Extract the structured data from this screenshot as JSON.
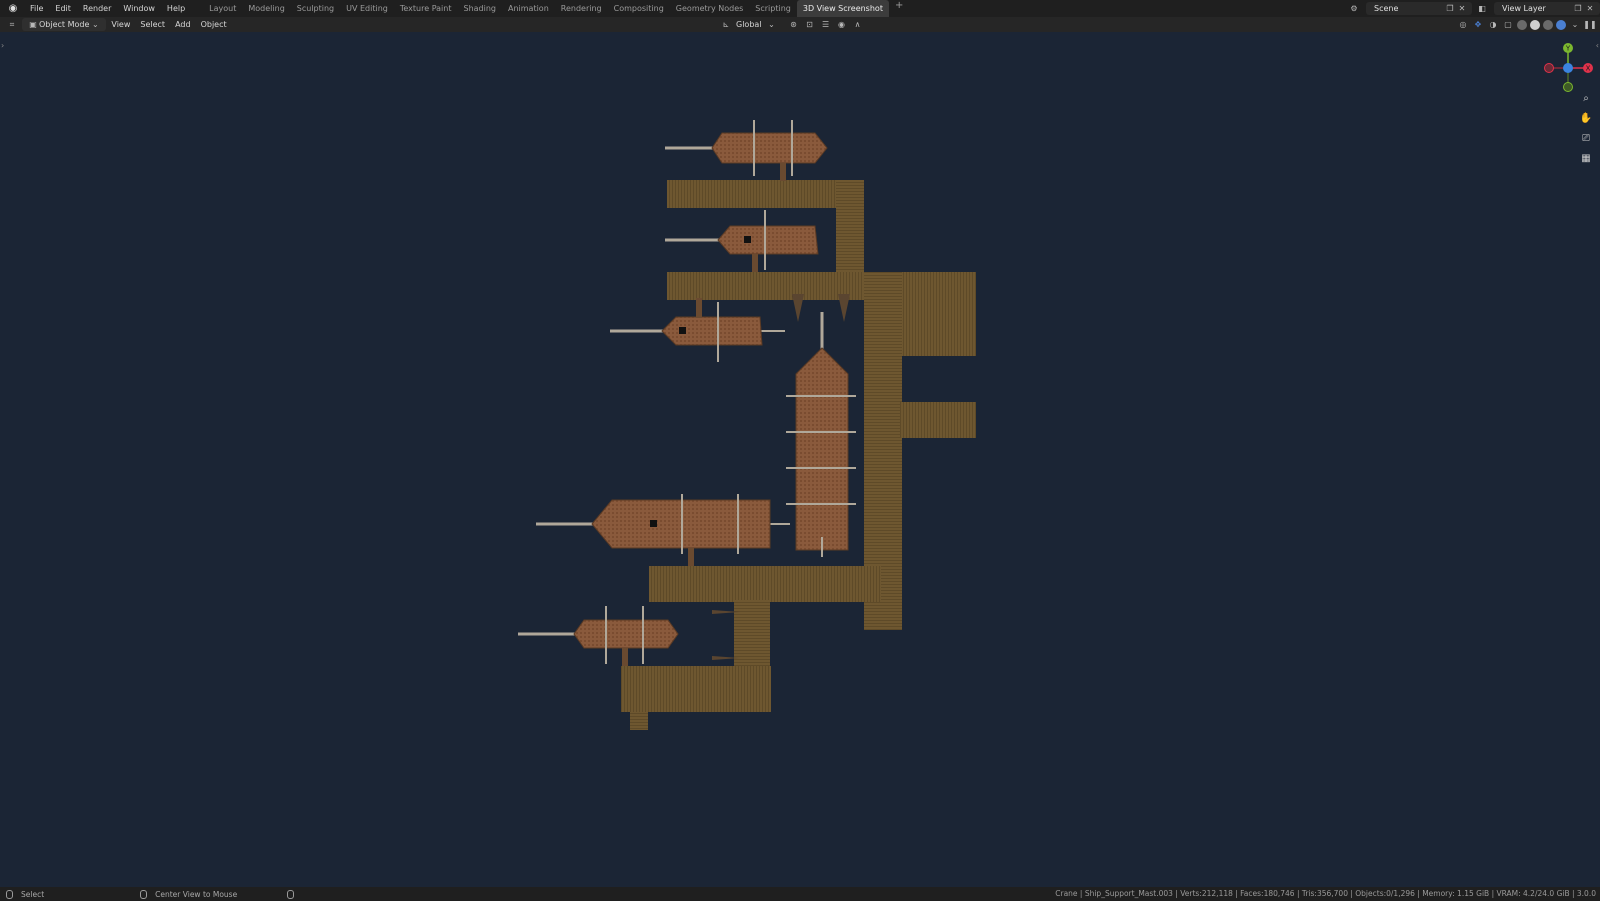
{
  "menu": {
    "items": [
      "File",
      "Edit",
      "Render",
      "Window",
      "Help"
    ],
    "workspaces": [
      "Layout",
      "Modeling",
      "Sculpting",
      "UV Editing",
      "Texture Paint",
      "Shading",
      "Animation",
      "Rendering",
      "Compositing",
      "Geometry Nodes",
      "Scripting",
      "3D View Screenshot"
    ],
    "active_workspace": "3D View Screenshot",
    "add_tab": "+"
  },
  "top_right": {
    "scene_label": "Scene",
    "view_layer_label": "View Layer"
  },
  "header": {
    "mode": "Object Mode",
    "menus": [
      "View",
      "Select",
      "Add",
      "Object"
    ],
    "transform_orientation": "Global"
  },
  "gizmo": {
    "y_label": "Y",
    "x_label": "X",
    "colors": {
      "x": "#e0324b",
      "y": "#7cb82f",
      "z": "#3b84e0"
    }
  },
  "statusbar": {
    "left_action": "Select",
    "middle_action": "Center View to Mouse",
    "stats": "Crane | Ship_Support_Mast.003 | Verts:212,118 | Faces:180,746 | Tris:356,700 | Objects:0/1,296 | Memory: 1.15 GiB | VRAM: 4.2/24.0 GiB | 3.0.0"
  },
  "colors": {
    "viewport_bg": "#1b2535",
    "dock_wood": "#6e5730",
    "ship_hull": "#8a5a3c",
    "accent": "#4a7fd1"
  }
}
